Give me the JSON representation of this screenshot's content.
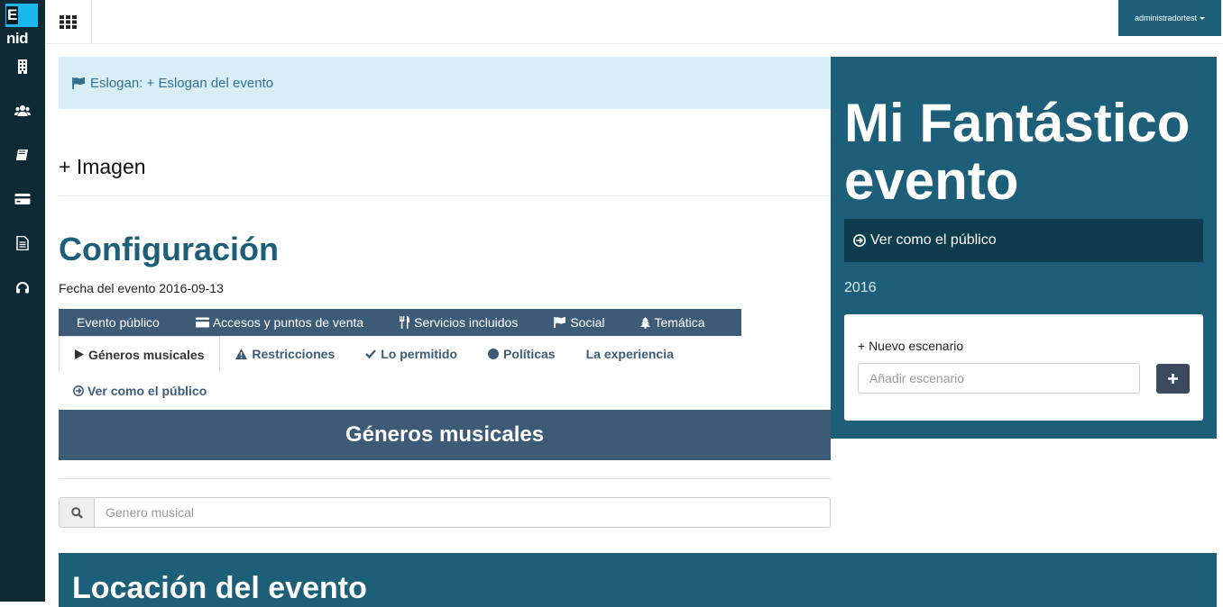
{
  "app": {
    "logo_text": "Enid",
    "logo_letter": "E",
    "logo_rest": "nid"
  },
  "sidebar": {
    "items": [
      {
        "icon": "building-icon"
      },
      {
        "icon": "users-icon"
      },
      {
        "icon": "book-icon"
      },
      {
        "icon": "credit-card-icon"
      },
      {
        "icon": "file-text-icon"
      },
      {
        "icon": "headphones-icon"
      }
    ]
  },
  "topbar": {
    "user_label": "administradortest"
  },
  "slogan": {
    "text": "Eslogan: + Eslogan del evento"
  },
  "imagen": {
    "label": "+ Imagen"
  },
  "config": {
    "title": "Configuración",
    "fecha": "Fecha del evento 2016-09-13"
  },
  "tabs_primary": [
    {
      "label": "Evento público",
      "icon": ""
    },
    {
      "label": "Accesos y puntos de venta",
      "icon": "credit-card-icon"
    },
    {
      "label": "Servicios incluidos",
      "icon": "cutlery-icon"
    },
    {
      "label": "Social",
      "icon": "flag-icon"
    },
    {
      "label": "Temática",
      "icon": "tree-icon"
    }
  ],
  "tabs_secondary": [
    {
      "label": "Géneros musicales",
      "icon": "play-icon",
      "active": true
    },
    {
      "label": "Restricciones",
      "icon": "warning-icon"
    },
    {
      "label": "Lo permitido",
      "icon": "check-icon"
    },
    {
      "label": "Políticas",
      "icon": "circle-icon"
    },
    {
      "label": "La experiencia",
      "icon": ""
    }
  ],
  "tabs_tertiary": {
    "label": "Ver como el público",
    "icon": "arrow-circle-right-icon"
  },
  "generos": {
    "header": "Géneros musicales",
    "search_placeholder": "Genero musical"
  },
  "event": {
    "title": "Mi Fantástico evento",
    "ver_publico": "Ver como el público",
    "year": "2016",
    "nuevo_escenario": "+ Nuevo escenario",
    "escenario_placeholder": "Añadir escenario"
  },
  "location": {
    "title": "Locación del evento"
  },
  "colors": {
    "sidebar_bg": "#0f2a35",
    "primary": "#1d5f78",
    "tab_bg": "#3d5a77",
    "alert_bg": "#d9edf7",
    "logo_bg": "#1ab8ef"
  }
}
